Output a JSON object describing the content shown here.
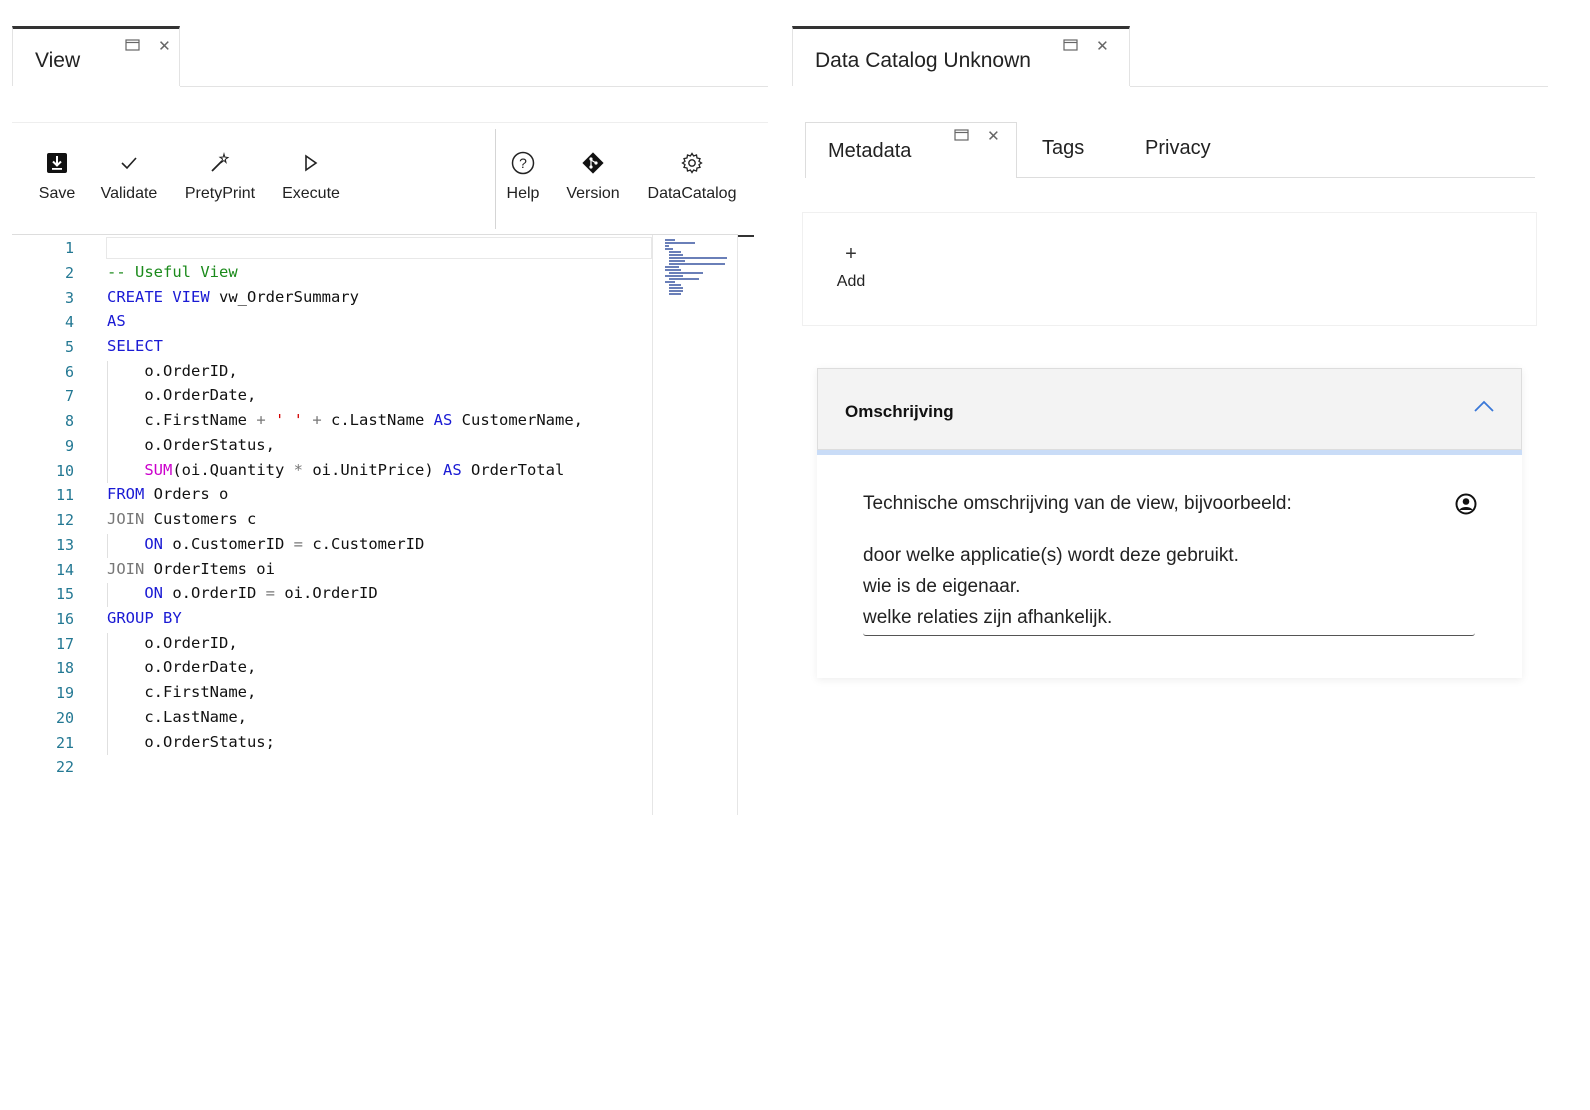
{
  "left_window": {
    "tab_title": "View",
    "toolbar": {
      "save": "Save",
      "validate": "Validate",
      "pretty_print": "PretyPrint",
      "execute": "Execute",
      "help": "Help",
      "version": "Version",
      "data_catalog": "DataCatalog"
    },
    "editor": {
      "line_numbers": [
        "1",
        "2",
        "3",
        "4",
        "5",
        "6",
        "7",
        "8",
        "9",
        "10",
        "11",
        "12",
        "13",
        "14",
        "15",
        "16",
        "17",
        "18",
        "19",
        "20",
        "21",
        "22"
      ]
    }
  },
  "right_window": {
    "tab_title": "Data Catalog Unknown",
    "tabs": [
      "Metadata",
      "Tags",
      "Privacy"
    ],
    "add_label": "Add",
    "accordion": {
      "title": "Omschrijving",
      "lines": [
        "Technische omschrijving van de view, bijvoorbeeld:",
        "door welke applicatie(s) wordt deze gebruikt.",
        "wie is de eigenaar.",
        "welke relaties zijn afhankelijk."
      ]
    }
  },
  "colors": {
    "keyword": "#1a1ad4",
    "comment": "#1b8a1b",
    "string": "#d40000",
    "function": "#cc00cc",
    "line_number": "#237893",
    "accordion_accent": "#c9dcf7"
  }
}
